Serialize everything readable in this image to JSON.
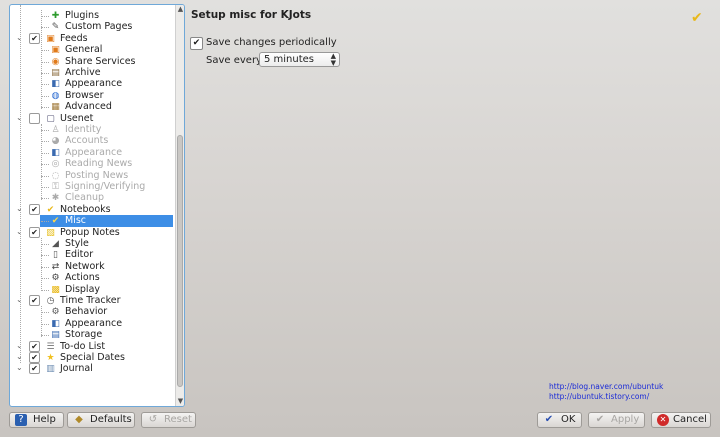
{
  "sidebar": {
    "items": [
      {
        "label": "Plugins",
        "icon": "puzzle-icon",
        "level": 2,
        "dim": false
      },
      {
        "label": "Custom Pages",
        "icon": "pen-icon",
        "level": 2,
        "dim": false
      },
      {
        "label": "Feeds",
        "icon": "feeds-icon",
        "level": 1,
        "dim": false
      },
      {
        "label": "General",
        "icon": "feeds-icon",
        "level": 2,
        "dim": false
      },
      {
        "label": "Share Services",
        "icon": "share-icon",
        "level": 2,
        "dim": false
      },
      {
        "label": "Archive",
        "icon": "archive-icon",
        "level": 2,
        "dim": false
      },
      {
        "label": "Appearance",
        "icon": "appearance-icon",
        "level": 2,
        "dim": false
      },
      {
        "label": "Browser",
        "icon": "globe-icon",
        "level": 2,
        "dim": false
      },
      {
        "label": "Advanced",
        "icon": "box-icon",
        "level": 2,
        "dim": false
      },
      {
        "label": "Usenet",
        "icon": "usenet-icon",
        "level": 1,
        "dim": false
      },
      {
        "label": "Identity",
        "icon": "identity-icon",
        "level": 2,
        "dim": true
      },
      {
        "label": "Accounts",
        "icon": "accounts-icon",
        "level": 2,
        "dim": true
      },
      {
        "label": "Appearance",
        "icon": "appearance-icon",
        "level": 2,
        "dim": true
      },
      {
        "label": "Reading News",
        "icon": "reading-icon",
        "level": 2,
        "dim": true
      },
      {
        "label": "Posting News",
        "icon": "posting-icon",
        "level": 2,
        "dim": true
      },
      {
        "label": "Signing/Verifying",
        "icon": "signing-icon",
        "level": 2,
        "dim": true
      },
      {
        "label": "Cleanup",
        "icon": "cleanup-icon",
        "level": 2,
        "dim": true
      },
      {
        "label": "Notebooks",
        "icon": "kjots-icon",
        "level": 1,
        "dim": false
      },
      {
        "label": "Misc",
        "icon": "kjots-icon",
        "level": 2,
        "dim": false,
        "selected": true
      },
      {
        "label": "Popup Notes",
        "icon": "notes-icon",
        "level": 1,
        "dim": false
      },
      {
        "label": "Style",
        "icon": "style-icon",
        "level": 2,
        "dim": false
      },
      {
        "label": "Editor",
        "icon": "editor-icon",
        "level": 2,
        "dim": false
      },
      {
        "label": "Network",
        "icon": "network-icon",
        "level": 2,
        "dim": false
      },
      {
        "label": "Actions",
        "icon": "actions-icon",
        "level": 2,
        "dim": false
      },
      {
        "label": "Display",
        "icon": "display-icon",
        "level": 2,
        "dim": false
      },
      {
        "label": "Time Tracker",
        "icon": "clock-icon",
        "level": 1,
        "dim": false
      },
      {
        "label": "Behavior",
        "icon": "behavior-icon",
        "level": 2,
        "dim": false
      },
      {
        "label": "Appearance",
        "icon": "appearance-icon",
        "level": 2,
        "dim": false
      },
      {
        "label": "Storage",
        "icon": "storage-icon",
        "level": 2,
        "dim": false
      },
      {
        "label": "To-do List",
        "icon": "todo-icon",
        "level": 1,
        "dim": false
      },
      {
        "label": "Special Dates",
        "icon": "star-icon",
        "level": 1,
        "dim": false
      },
      {
        "label": "Journal",
        "icon": "journal-icon",
        "level": 1,
        "dim": false
      }
    ]
  },
  "main": {
    "title": "Setup misc for KJots",
    "save_periodically_label": "Save changes periodically",
    "save_periodically_checked": true,
    "save_every_label": "Save every:",
    "save_every_value": "5 minutes",
    "links": [
      "http://blog.naver.com/ubuntuk",
      "http://ubuntuk.tistory.com/"
    ]
  },
  "buttons": {
    "help": "Help",
    "defaults": "Defaults",
    "reset": "Reset",
    "ok": "OK",
    "apply": "Apply",
    "cancel": "Cancel"
  },
  "colors": {
    "accent": "#3d8ee6",
    "link": "#1a2bd6"
  }
}
